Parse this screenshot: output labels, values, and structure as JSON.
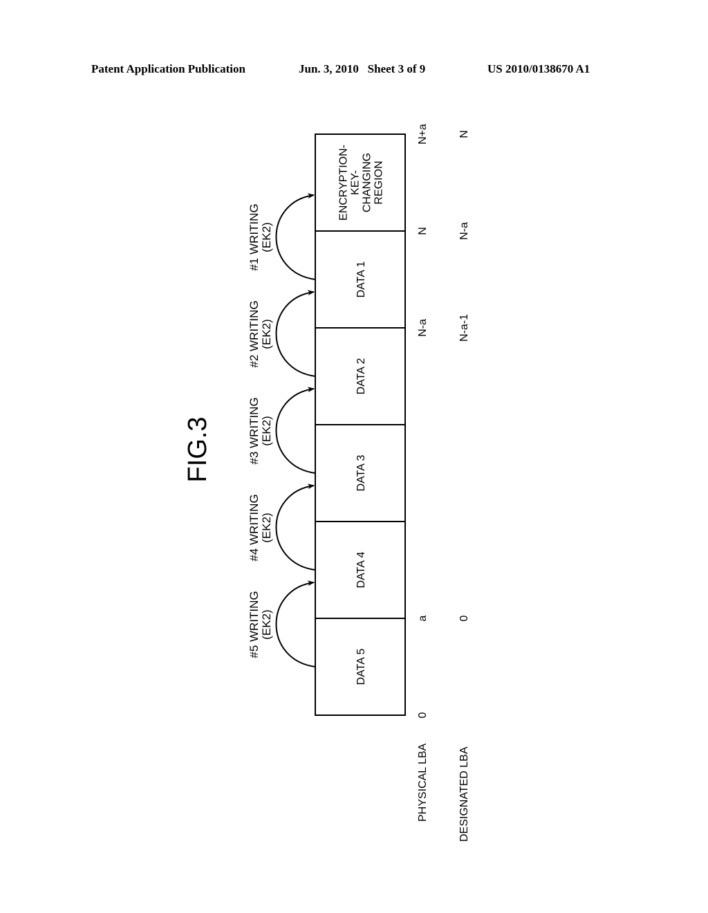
{
  "header": {
    "left": "Patent Application Publication",
    "center": "Jun. 3, 2010   Sheet 3 of 9",
    "right": "US 2010/0138670 A1"
  },
  "figure": {
    "title": "FIG.3",
    "cells": [
      {
        "label": [
          "DATA 5"
        ]
      },
      {
        "label": [
          "DATA 4"
        ]
      },
      {
        "label": [
          "DATA 3"
        ]
      },
      {
        "label": [
          "DATA 2"
        ]
      },
      {
        "label": [
          "DATA 1"
        ]
      },
      {
        "label": [
          "ENCRYPTION-",
          "KEY-",
          "CHANGING",
          "REGION"
        ]
      }
    ],
    "writes": [
      {
        "label": "#5 WRITING",
        "key": "(EK2)"
      },
      {
        "label": "#4 WRITING",
        "key": "(EK2)"
      },
      {
        "label": "#3 WRITING",
        "key": "(EK2)"
      },
      {
        "label": "#2 WRITING",
        "key": "(EK2)"
      },
      {
        "label": "#1 WRITING",
        "key": "(EK2)"
      }
    ],
    "physical_lba": {
      "label": "PHYSICAL LBA",
      "marks": [
        {
          "boundary": 0,
          "text": "0"
        },
        {
          "boundary": 1,
          "text": "a"
        },
        {
          "boundary": 4,
          "text": "N-a"
        },
        {
          "boundary": 5,
          "text": "N"
        },
        {
          "boundary": 6,
          "text": "N+a"
        }
      ]
    },
    "designated_lba": {
      "label": "DESIGNATED LBA",
      "marks": [
        {
          "boundary": 1,
          "text": "0"
        },
        {
          "boundary": 4,
          "text": "N-a-1"
        },
        {
          "boundary": 5,
          "text": "N-a"
        },
        {
          "boundary": 6,
          "text": "N"
        }
      ]
    }
  }
}
